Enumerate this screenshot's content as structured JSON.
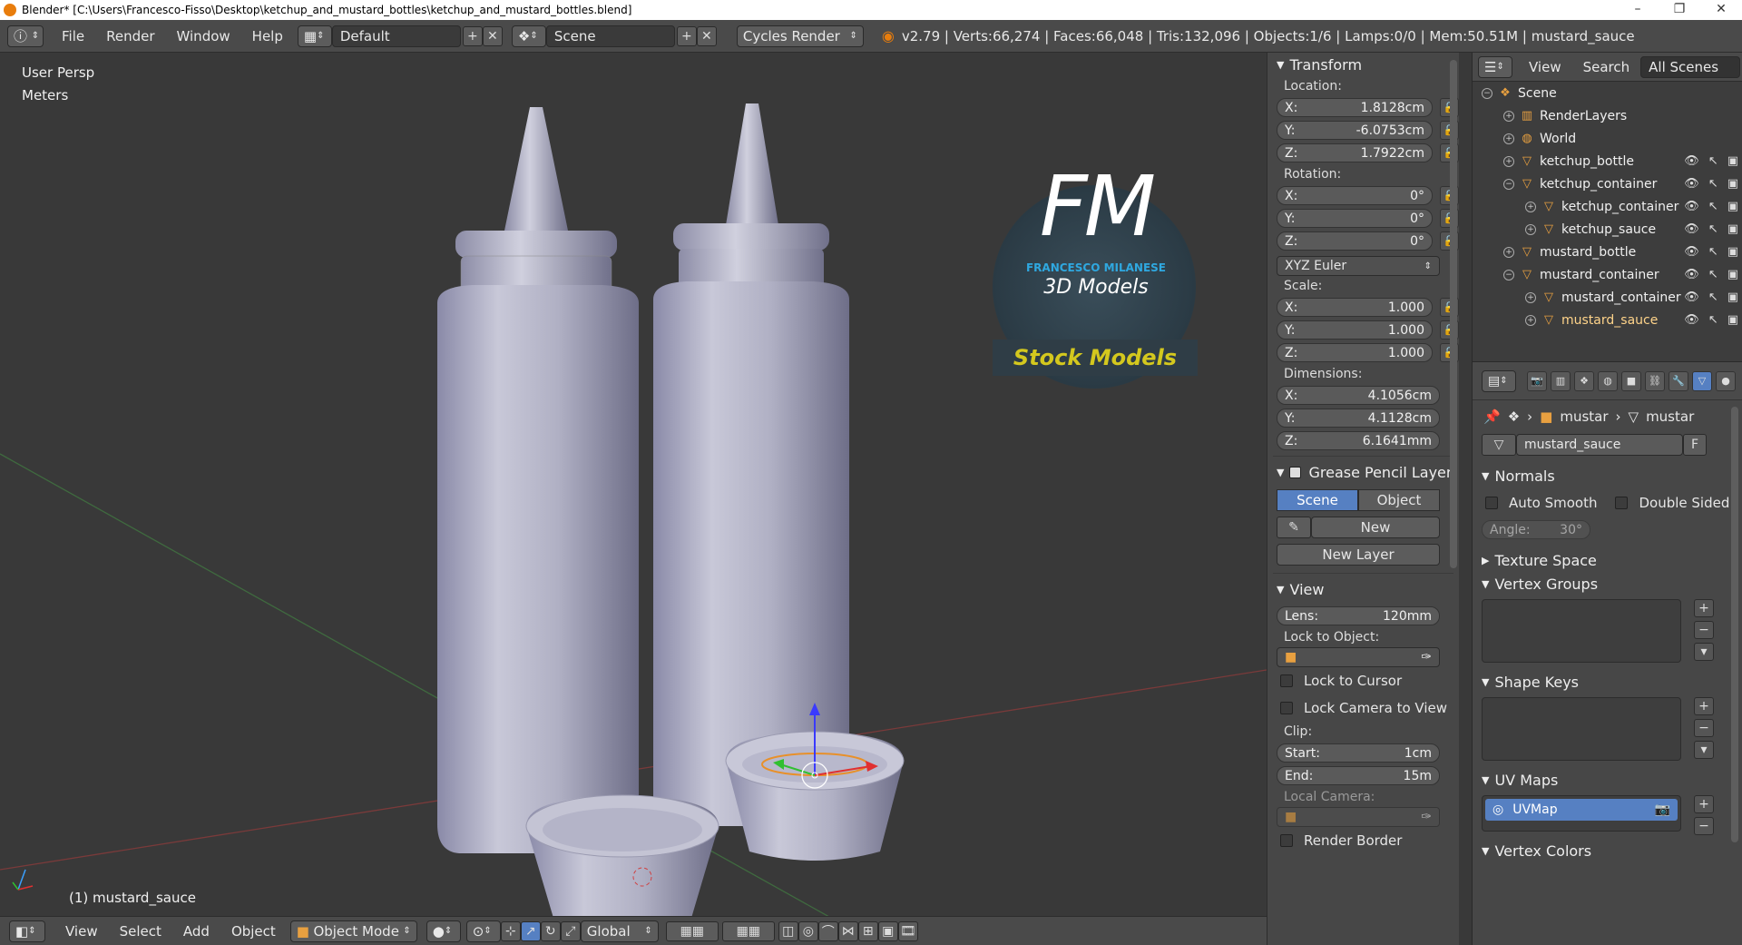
{
  "window": {
    "title": "Blender* [C:\\Users\\Francesco-Fisso\\Desktop\\ketchup_and_mustard_bottles\\ketchup_and_mustard_bottles.blend]",
    "minimize": "–",
    "maximize": "❐",
    "close": "✕"
  },
  "topbar": {
    "menus": [
      "File",
      "Render",
      "Window",
      "Help"
    ],
    "screen_layout": "Default",
    "scene": "Scene",
    "engine": "Cycles Render",
    "stats": "v2.79 | Verts:66,274 | Faces:66,048 | Tris:132,096 | Objects:1/6 | Lamps:0/0 | Mem:50.51M | mustard_sauce"
  },
  "viewport": {
    "view_name": "User Persp",
    "units": "Meters",
    "active_object": "(1) mustard_sauce",
    "watermark_initials": "FM",
    "watermark_name": "FRANCESCO MILANESE",
    "watermark_sub": "3D Models",
    "watermark_badge": "Stock Models"
  },
  "bottombar": {
    "menus": [
      "View",
      "Select",
      "Add",
      "Object"
    ],
    "mode": "Object Mode",
    "orientation": "Global"
  },
  "npanel": {
    "transform_title": "Transform",
    "location_label": "Location:",
    "location": [
      {
        "axis": "X:",
        "value": "1.8128cm"
      },
      {
        "axis": "Y:",
        "value": "-6.0753cm"
      },
      {
        "axis": "Z:",
        "value": "1.7922cm"
      }
    ],
    "rotation_label": "Rotation:",
    "rotation": [
      {
        "axis": "X:",
        "value": "0°"
      },
      {
        "axis": "Y:",
        "value": "0°"
      },
      {
        "axis": "Z:",
        "value": "0°"
      }
    ],
    "rotation_mode": "XYZ Euler",
    "scale_label": "Scale:",
    "scale": [
      {
        "axis": "X:",
        "value": "1.000"
      },
      {
        "axis": "Y:",
        "value": "1.000"
      },
      {
        "axis": "Z:",
        "value": "1.000"
      }
    ],
    "dimensions_label": "Dimensions:",
    "dimensions": [
      {
        "axis": "X:",
        "value": "4.1056cm"
      },
      {
        "axis": "Y:",
        "value": "4.1128cm"
      },
      {
        "axis": "Z:",
        "value": "6.1641mm"
      }
    ],
    "grease_title": "Grease Pencil Layer",
    "grease_scene": "Scene",
    "grease_object": "Object",
    "grease_new": "New",
    "grease_new_layer": "New Layer",
    "view_title": "View",
    "lens_label": "Lens:",
    "lens_value": "120mm",
    "lock_object_label": "Lock to Object:",
    "lock_cursor": "Lock to Cursor",
    "lock_camera": "Lock Camera to View",
    "clip_label": "Clip:",
    "clip_start_label": "Start:",
    "clip_start": "1cm",
    "clip_end_label": "End:",
    "clip_end": "15m",
    "local_camera": "Local Camera:",
    "render_border": "Render Border"
  },
  "outliner": {
    "menu_view": "View",
    "menu_search": "Search",
    "filter": "All Scenes",
    "items": [
      {
        "label": "Scene",
        "depth": 0
      },
      {
        "label": "RenderLayers",
        "depth": 1
      },
      {
        "label": "World",
        "depth": 1
      },
      {
        "label": "ketchup_bottle",
        "depth": 1
      },
      {
        "label": "ketchup_container",
        "depth": 1
      },
      {
        "label": "ketchup_container",
        "depth": 2
      },
      {
        "label": "ketchup_sauce",
        "depth": 2
      },
      {
        "label": "mustard_bottle",
        "depth": 1
      },
      {
        "label": "mustard_container",
        "depth": 1
      },
      {
        "label": "mustard_container",
        "depth": 2
      },
      {
        "label": "mustard_sauce",
        "depth": 2
      }
    ]
  },
  "properties": {
    "breadcrumb_obj": "mustar",
    "breadcrumb_mesh": "mustar",
    "mesh_name": "mustard_sauce",
    "fake_user": "F",
    "normals_title": "Normals",
    "auto_smooth": "Auto Smooth",
    "double_sided": "Double Sided",
    "angle_label": "Angle:",
    "angle_value": "30°",
    "texture_space": "Texture Space",
    "vertex_groups": "Vertex Groups",
    "shape_keys": "Shape Keys",
    "uv_maps": "UV Maps",
    "uv_map_name": "UVMap",
    "vertex_colors": "Vertex Colors"
  }
}
